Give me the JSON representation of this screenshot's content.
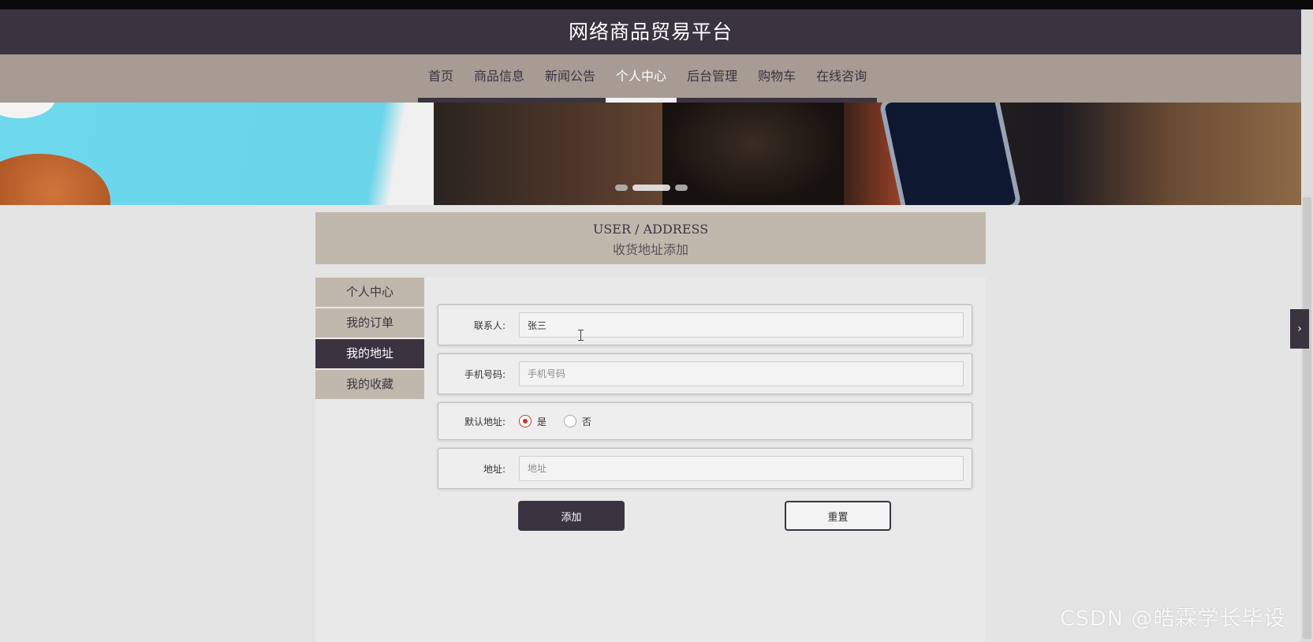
{
  "site": {
    "title": "网络商品贸易平台"
  },
  "nav": {
    "items": [
      {
        "label": "首页",
        "active": false
      },
      {
        "label": "商品信息",
        "active": false
      },
      {
        "label": "新闻公告",
        "active": false
      },
      {
        "label": "个人中心",
        "active": true
      },
      {
        "label": "后台管理",
        "active": false
      },
      {
        "label": "购物车",
        "active": false
      },
      {
        "label": "在线咨询",
        "active": false
      }
    ]
  },
  "banner": {
    "slide_count": 3,
    "active_slide": 2
  },
  "page_header": {
    "title_en": "USER / ADDRESS",
    "title_zh": "收货地址添加"
  },
  "sidebar": {
    "items": [
      {
        "label": "个人中心",
        "active": false
      },
      {
        "label": "我的订单",
        "active": false
      },
      {
        "label": "我的地址",
        "active": true
      },
      {
        "label": "我的收藏",
        "active": false
      }
    ]
  },
  "form": {
    "contact": {
      "label": "联系人:",
      "value": "张三",
      "placeholder": ""
    },
    "phone": {
      "label": "手机号码:",
      "value": "",
      "placeholder": "手机号码"
    },
    "default": {
      "label": "默认地址:",
      "options": [
        "是",
        "否"
      ],
      "selected": "是"
    },
    "address": {
      "label": "地址:",
      "value": "",
      "placeholder": "地址"
    },
    "add_label": "添加",
    "reset_label": "重置"
  },
  "side_toggle": {
    "icon": "chevron-right-icon",
    "glyph": "›"
  },
  "watermark": "CSDN @皓霖学长毕设",
  "colors": {
    "primary": "#3a3441",
    "nav_bg": "#a79b94",
    "tan": "#c1b8ad",
    "radio_checked": "#c0392b"
  }
}
